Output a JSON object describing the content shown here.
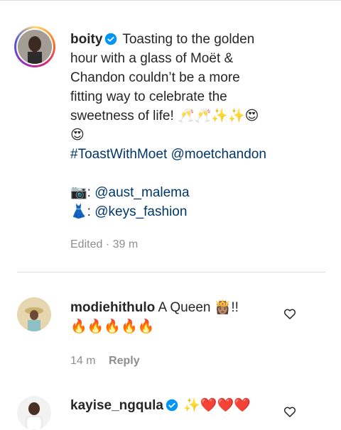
{
  "post": {
    "username": "boity",
    "caption_lines": [
      "Toasting to the golden",
      "hour with a glass of Moët &",
      "Chandon couldn’t be a more",
      "fitting way to celebrate the",
      "sweetness of life!"
    ],
    "caption_emoji_end": "🥂🥂✨✨😍",
    "caption_emoji_line": "😍",
    "hashtag": "#ToastWithMoet",
    "mention": "@moetchandon",
    "credit_photo_icon": "📷",
    "credit_photo": "@aust_malema",
    "credit_dress_icon": "👗",
    "credit_dress": "@keys_fashion",
    "edited_label": "Edited",
    "time": "39 m"
  },
  "comments": [
    {
      "username": "modiehithulo",
      "text": "A Queen",
      "emoji": "👸🏽",
      "text_suffix": "!!",
      "emoji_line": "🔥🔥🔥🔥🔥",
      "time": "14 m",
      "reply_label": "Reply"
    },
    {
      "username": "kayise_ngqula",
      "emoji": "✨❤️❤️❤️"
    }
  ],
  "icons": {
    "verified": "verified-badge-icon",
    "like": "heart-outline-icon"
  },
  "colors": {
    "link": "#00376b",
    "verified": "#0095f6",
    "muted": "#8e8e8e"
  }
}
